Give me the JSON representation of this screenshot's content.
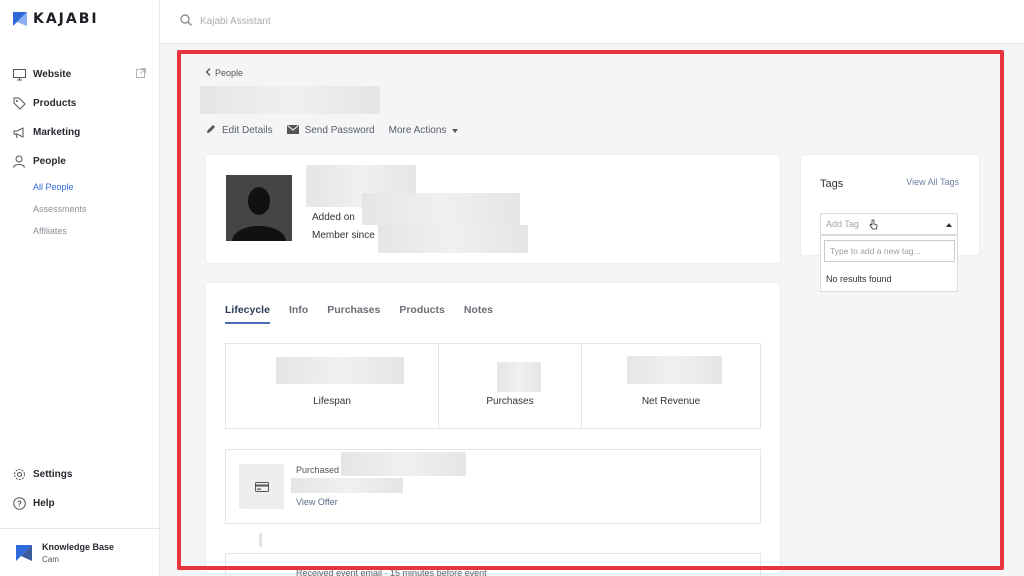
{
  "brand": {
    "name": "KAJABI",
    "accent": "#2f6ad9"
  },
  "search": {
    "placeholder": "Kajabi Assistant"
  },
  "sidebar": {
    "items": [
      {
        "label": "Website",
        "icon": "monitor-icon"
      },
      {
        "label": "Products",
        "icon": "tag-icon"
      },
      {
        "label": "Marketing",
        "icon": "megaphone-icon"
      },
      {
        "label": "People",
        "icon": "person-icon"
      }
    ],
    "people_sub": [
      "All People",
      "Assessments",
      "Affiliates"
    ],
    "bottom": [
      {
        "label": "Settings",
        "icon": "gear-icon"
      },
      {
        "label": "Help",
        "icon": "help-icon"
      }
    ],
    "knowledge_base": {
      "title": "Knowledge Base",
      "user": "Cam"
    }
  },
  "breadcrumb": {
    "back": "People"
  },
  "actions": {
    "edit": "Edit Details",
    "send": "Send Password",
    "more": "More Actions"
  },
  "profile": {
    "added_on": "Added on ",
    "member_since": "Member since"
  },
  "tags": {
    "title": "Tags",
    "view_all": "View All Tags",
    "select_placeholder": "Add Tag",
    "input_placeholder": "Type to add a new tag...",
    "no_results": "No results found"
  },
  "tabs": [
    "Lifecycle",
    "Info",
    "Purchases",
    "Products",
    "Notes"
  ],
  "stats": [
    "Lifespan",
    "Purchases",
    "Net Revenue"
  ],
  "purchase": {
    "label": "Purchased",
    "link": "View Offer"
  },
  "event": {
    "text": "Received event email · 15 minutes before event"
  },
  "highlight_color": "#e8343c"
}
